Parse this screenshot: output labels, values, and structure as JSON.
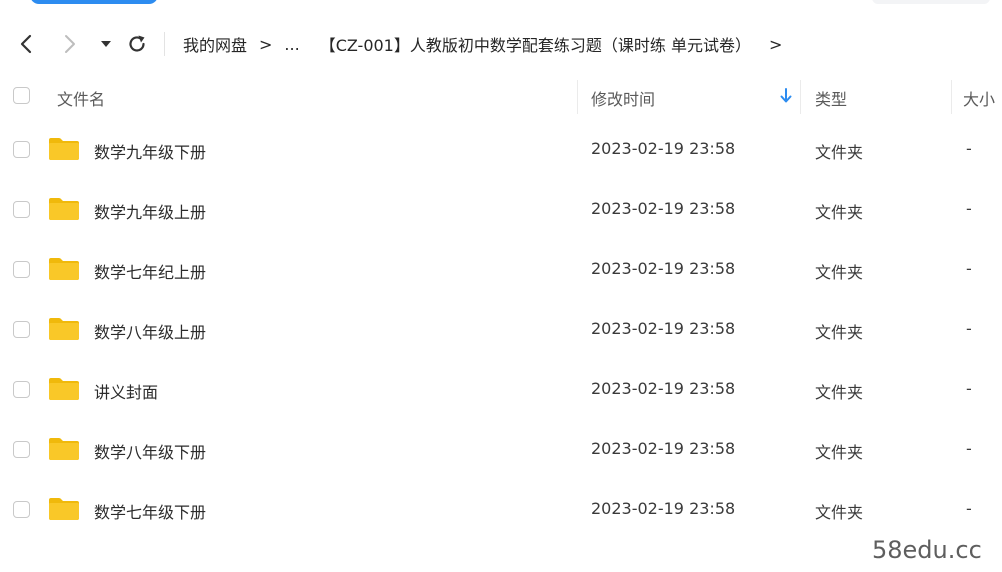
{
  "nav": {
    "back_icon": "chevron-left-icon",
    "forward_icon": "chevron-right-icon",
    "history_dropdown_icon": "caret-down-icon",
    "refresh_icon": "refresh-icon"
  },
  "breadcrumb": {
    "root": "我的网盘",
    "sep1": ">",
    "ellipsis": "...",
    "current": "【CZ-001】人教版初中数学配套练习题（课时练 单元试卷）",
    "trailing_sep": ">"
  },
  "columns": {
    "name": "文件名",
    "modified": "修改时间",
    "type": "类型",
    "size": "大小",
    "sort_icon": "arrow-down-icon",
    "sort_color": "#2d8cf0"
  },
  "files": [
    {
      "name": "数学九年级下册",
      "modified": "2023-02-19 23:58",
      "type": "文件夹",
      "size": "-",
      "icon": "folder-icon"
    },
    {
      "name": "数学九年级上册",
      "modified": "2023-02-19 23:58",
      "type": "文件夹",
      "size": "-",
      "icon": "folder-icon"
    },
    {
      "name": "数学七年纪上册",
      "modified": "2023-02-19 23:58",
      "type": "文件夹",
      "size": "-",
      "icon": "folder-icon"
    },
    {
      "name": "数学八年级上册",
      "modified": "2023-02-19 23:58",
      "type": "文件夹",
      "size": "-",
      "icon": "folder-icon"
    },
    {
      "name": "讲义封面",
      "modified": "2023-02-19 23:58",
      "type": "文件夹",
      "size": "-",
      "icon": "folder-icon"
    },
    {
      "name": "数学八年级下册",
      "modified": "2023-02-19 23:58",
      "type": "文件夹",
      "size": "-",
      "icon": "folder-icon"
    },
    {
      "name": "数学七年级下册",
      "modified": "2023-02-19 23:58",
      "type": "文件夹",
      "size": "-",
      "icon": "folder-icon"
    }
  ],
  "colors": {
    "folder": "#f9c828",
    "folder_back": "#f0b90b",
    "accent": "#2d8cf0"
  },
  "watermark": "58edu.cc"
}
